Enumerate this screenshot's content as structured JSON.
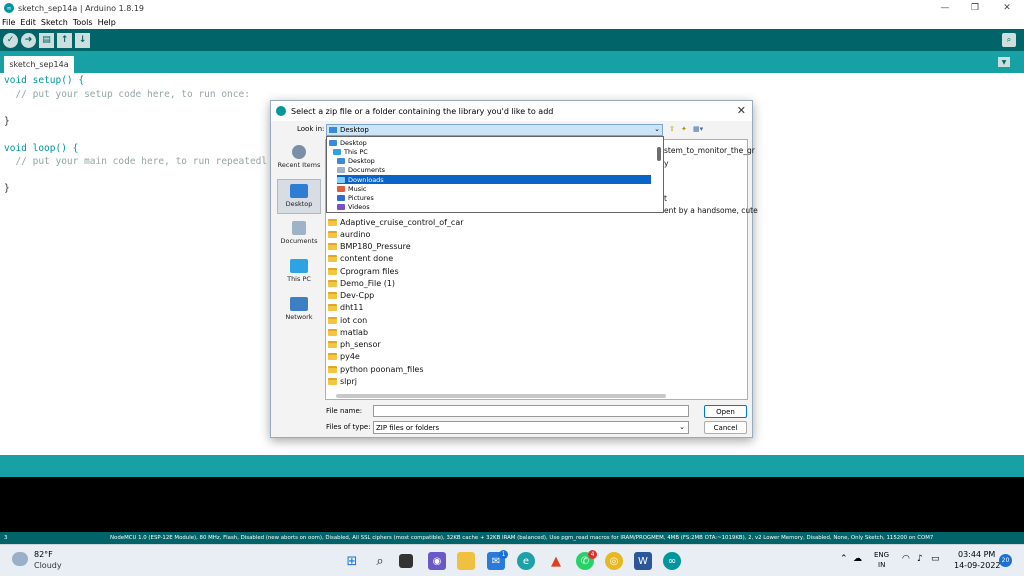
{
  "window": {
    "title": "sketch_sep14a | Arduino 1.8.19"
  },
  "menu": [
    "File",
    "Edit",
    "Sketch",
    "Tools",
    "Help"
  ],
  "tab": {
    "label": "sketch_sep14a"
  },
  "code": {
    "setup_sig": "void setup() {",
    "setup_comment": "  // put your setup code here, to run once:",
    "close1": "}",
    "loop_sig": "void loop() {",
    "loop_comment": "  // put your main code here, to run repeatedl",
    "close2": "}"
  },
  "status": {
    "line": "3",
    "board": "NodeMCU 1.0 (ESP-12E Module), 80 MHz, Flash, Disabled (new aborts on oom), Disabled, All SSL ciphers (most compatible), 32KB cache + 32KB IRAM (balanced), Use pgm_read macros for IRAM/PROGMEM, 4MB (FS:2MB OTA:~1019KB), 2, v2 Lower Memory, Disabled, None, Only Sketch, 115200 on COM7"
  },
  "dialog": {
    "title": "Select a zip file or a folder containing the library you'd like to add",
    "look_in_label": "Look in:",
    "look_in_value": "Desktop",
    "places": [
      {
        "label": "Recent Items"
      },
      {
        "label": "Desktop"
      },
      {
        "label": "Documents"
      },
      {
        "label": "This PC"
      },
      {
        "label": "Network"
      }
    ],
    "dropdown": [
      {
        "label": "Desktop"
      },
      {
        "label": "This PC"
      },
      {
        "label": "Desktop"
      },
      {
        "label": "Documents"
      },
      {
        "label": "Downloads"
      },
      {
        "label": "Music"
      },
      {
        "label": "Pictures"
      },
      {
        "label": "Videos"
      }
    ],
    "hidden_fragments": [
      "stem_to_monitor_the_gr",
      "y",
      "t",
      "ent by a  handsome, cute"
    ],
    "files": [
      "Adaptive_cruise_control_of_car",
      "aurdino",
      "BMP180_Pressure",
      "content done",
      "Cprogram files",
      "Demo_File (1)",
      "Dev-Cpp",
      "dht11",
      "iot con",
      "matlab",
      "ph_sensor",
      "py4e",
      "python poonam_files",
      "slprj"
    ],
    "file_name_label": "File name:",
    "file_name_value": "",
    "file_type_label": "Files of type:",
    "file_type_value": "ZIP files or folders",
    "open_label": "Open",
    "cancel_label": "Cancel"
  },
  "taskbar": {
    "weather_temp": "82°F",
    "weather_desc": "Cloudy",
    "lang1": "ENG",
    "lang2": "IN",
    "time": "03:44 PM",
    "date": "14-09-2022",
    "notif": "20",
    "badge_mail": "1",
    "badge_whatsapp": "4"
  },
  "colors": {
    "arduino_teal": "#00979c",
    "toolbar": "#006468",
    "selection": "#0a64c8"
  }
}
